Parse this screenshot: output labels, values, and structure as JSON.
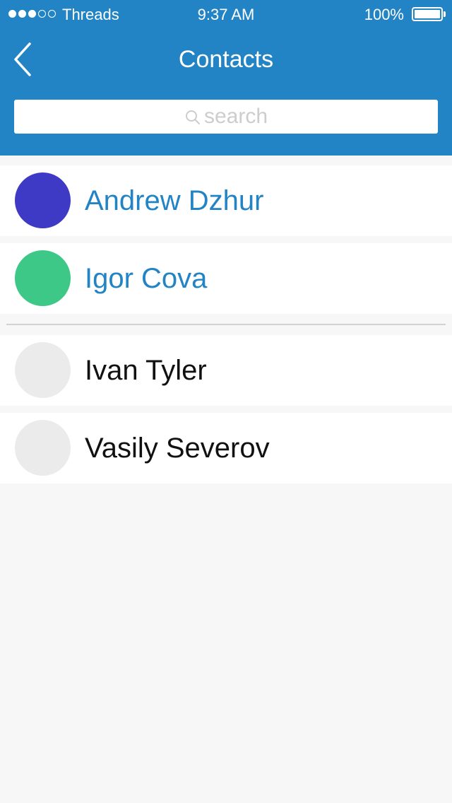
{
  "status_bar": {
    "carrier": "Threads",
    "time": "9:37 AM",
    "battery": "100%",
    "signal_bars_filled": 3,
    "signal_bars_total": 5
  },
  "nav": {
    "title": "Contacts",
    "back_icon": "chevron-left-icon"
  },
  "search": {
    "placeholder": "search",
    "icon": "search-icon"
  },
  "colors": {
    "header_bg": "#2284c5",
    "accent_text": "#2284c5",
    "page_bg": "#f7f7f7"
  },
  "favorites": [
    {
      "name": "Andrew Dzhur",
      "avatar_color": "#3f3ac6"
    },
    {
      "name": "Igor Cova",
      "avatar_color": "#3ec887"
    }
  ],
  "contacts": [
    {
      "name": "Ivan Tyler",
      "avatar_color": "#ebebeb"
    },
    {
      "name": "Vasily Severov",
      "avatar_color": "#ebebeb"
    }
  ]
}
